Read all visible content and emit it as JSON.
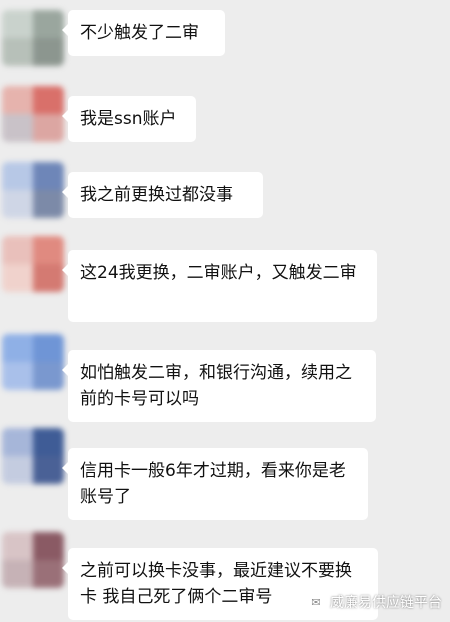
{
  "messages": [
    {
      "text": "不少触发了二审",
      "avatar_colors": [
        "#c9d2cc",
        "#9aa69e",
        "#b7c0b9",
        "#8c968f"
      ]
    },
    {
      "text": "我是ssn账户",
      "avatar_colors": [
        "#e6b3ad",
        "#d9706a",
        "#c9c2c8",
        "#dca6a2"
      ]
    },
    {
      "text": "我之前更换过都没事",
      "avatar_colors": [
        "#b7c8e6",
        "#6e86b8",
        "#cfd6e6",
        "#7c8aa8"
      ]
    },
    {
      "text": "这24我更换，二审账户，又触发二审",
      "avatar_colors": [
        "#e9c0bb",
        "#e08a80",
        "#f0d2cc",
        "#d47a72"
      ]
    },
    {
      "text": "如怕触发二审，和银行沟通，续用之前的卡号可以吗",
      "avatar_colors": [
        "#8fb0e6",
        "#6f95d6",
        "#a9c0ea",
        "#7a98cf"
      ]
    },
    {
      "text": "信用卡一般6年才过期，看来你是老账号了",
      "avatar_colors": [
        "#a6b6d9",
        "#3f5c96",
        "#c4cce0",
        "#4a6196"
      ]
    },
    {
      "text": "之前可以换卡没事，最近建议不要换卡 我自己死了俩个二审号",
      "avatar_colors": [
        "#d8c4c6",
        "#8a5a64",
        "#c6b2b6",
        "#9a7078"
      ]
    }
  ],
  "watermark": {
    "icon": "wechat-icon",
    "text": "威廉易供应链平台"
  }
}
